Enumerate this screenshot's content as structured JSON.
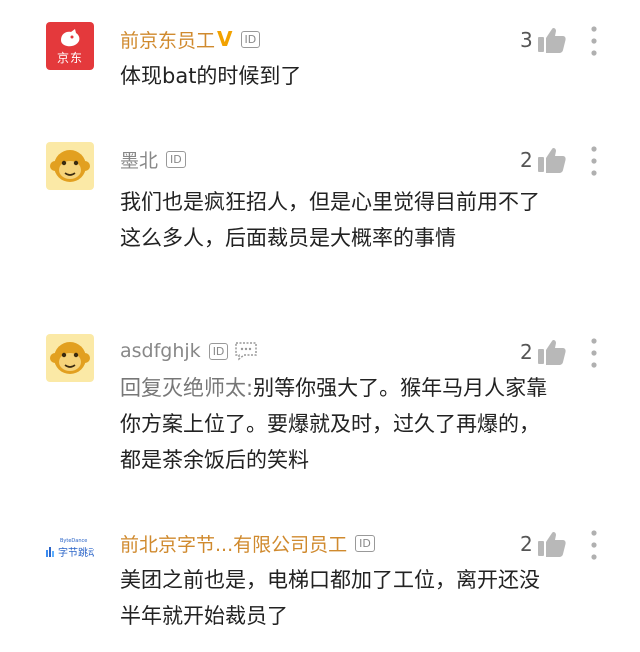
{
  "comments": [
    {
      "avatar_label": "京东",
      "username": "前京东员工",
      "verified": "V",
      "id_badge": "ID",
      "likes": "3",
      "text": "体现bat的时候到了"
    },
    {
      "username": "墨北",
      "id_badge": "ID",
      "likes": "2",
      "text": "我们也是疯狂招人，但是心里觉得目前用不了这么多人，后面裁员是大概率的事情"
    },
    {
      "username": "asdfghjk",
      "id_badge": "ID",
      "likes": "2",
      "reply_prefix": "回复灭绝师太:",
      "text": "别等你强大了。猴年马月人家靠你方案上位了。要爆就及时，过久了再爆的，都是茶余饭后的笑料"
    },
    {
      "avatar_label": "字节跳动",
      "avatar_small": "ByteDance",
      "username": "前北京字节...有限公司员工",
      "id_badge": "ID",
      "likes": "2",
      "text": "美团之前也是，电梯口都加了工位，离开还没半年就开始裁员了"
    }
  ]
}
